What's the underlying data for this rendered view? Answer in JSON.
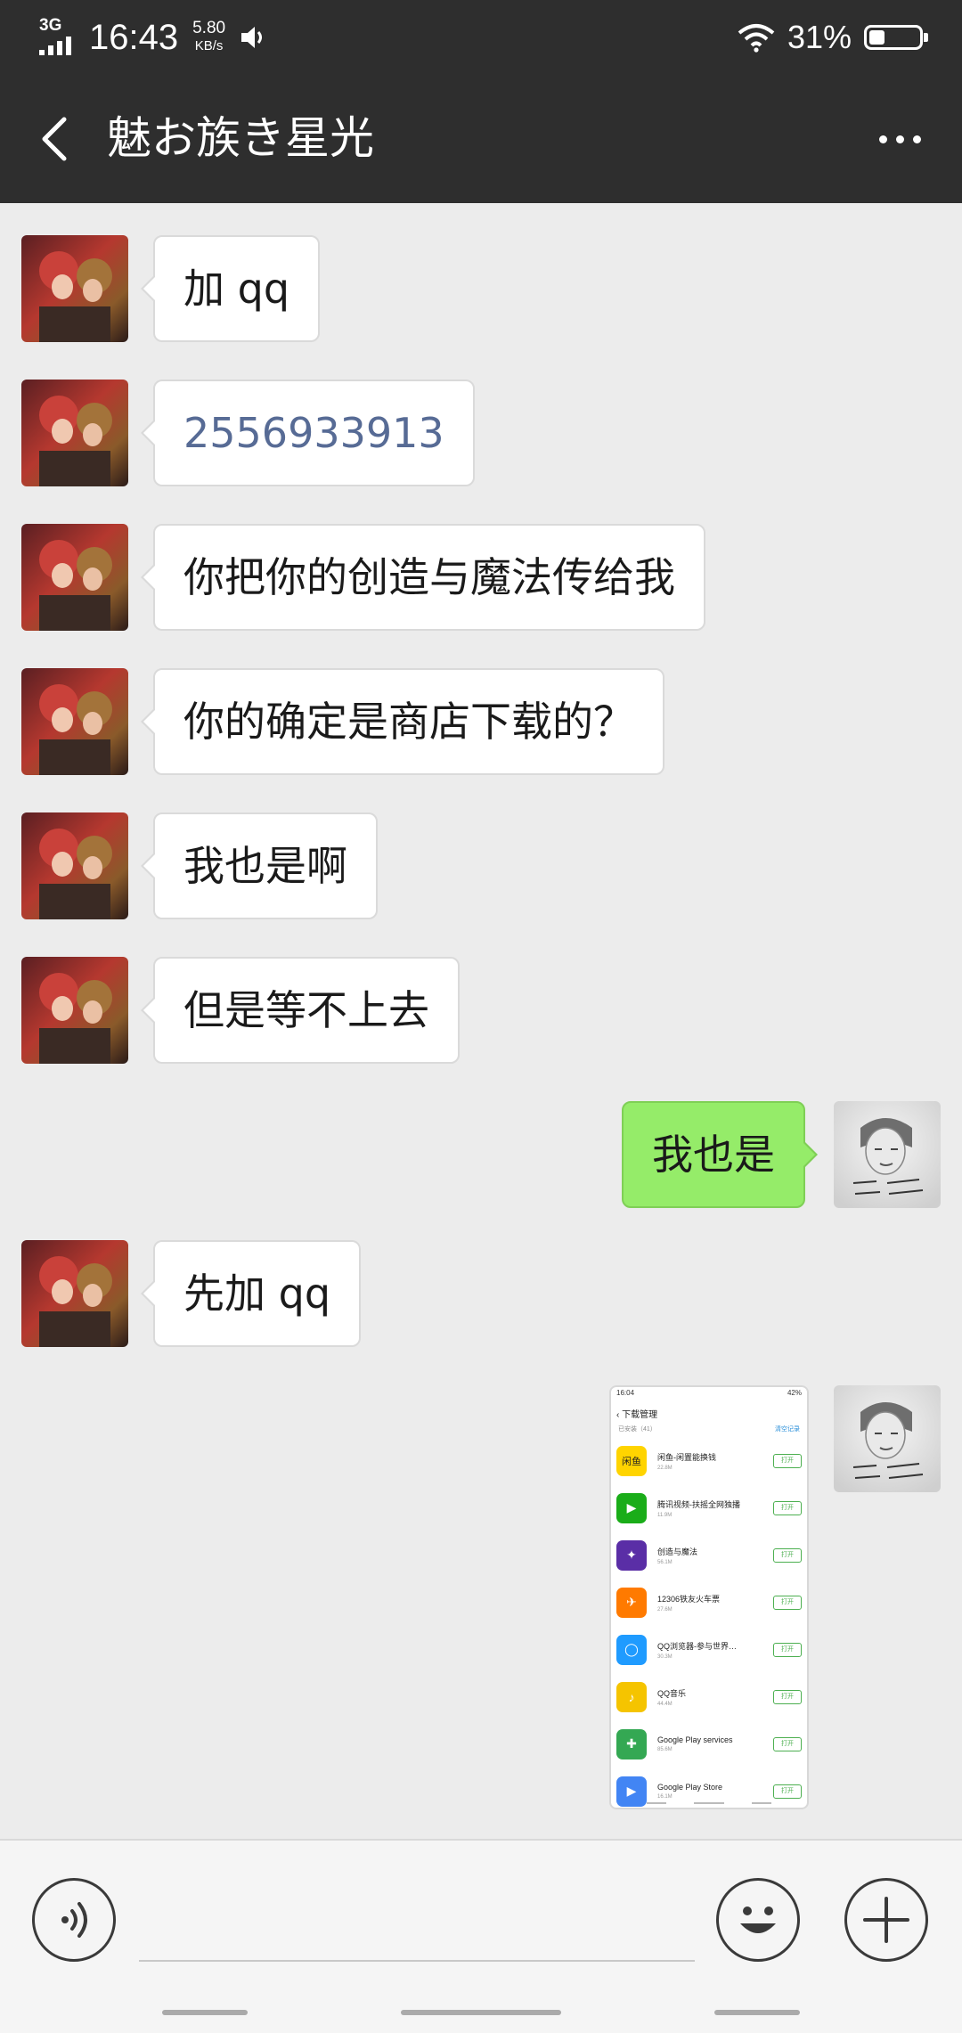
{
  "status_bar": {
    "network": "3G",
    "time": "16:43",
    "speed_value": "5.80",
    "speed_unit": "KB/s",
    "battery_text": "31%",
    "battery_level": 0.31
  },
  "header": {
    "title": "魅お族き星光"
  },
  "messages": [
    {
      "side": "left",
      "text": "加 qq"
    },
    {
      "side": "left",
      "text": "2556933913"
    },
    {
      "side": "left",
      "text": "你把你的创造与魔法传给我"
    },
    {
      "side": "left",
      "text": "你的确定是商店下载的？"
    },
    {
      "side": "left",
      "text": "我也是啊"
    },
    {
      "side": "left",
      "text": "但是等不上去"
    },
    {
      "side": "right",
      "text": "我也是"
    },
    {
      "side": "left",
      "text": "先加 qq"
    }
  ],
  "screenshot": {
    "status_time": "16:04",
    "status_battery": "42%",
    "title": "下载管理",
    "subtitle": "已安装（41）",
    "clear_label": "清空记录",
    "apps": [
      {
        "name": "闲鱼-闲置能换钱",
        "size": "22.8M",
        "icon": "闲鱼",
        "color": "#ffd400",
        "button": "打开"
      },
      {
        "name": "腾讯视频-扶摇全网独播",
        "size": "11.9M",
        "icon": "▶",
        "color": "#1aad19",
        "button": "打开"
      },
      {
        "name": "创造与魔法",
        "size": "56.1M",
        "icon": "✦",
        "color": "#5a2ea6",
        "button": "打开"
      },
      {
        "name": "12306铁友火车票",
        "size": "27.6M",
        "icon": "✈",
        "color": "#ff7a00",
        "button": "打开"
      },
      {
        "name": "QQ浏览器-参与世界…",
        "size": "30.3M",
        "icon": "◯",
        "color": "#1f9bff",
        "button": "打开"
      },
      {
        "name": "QQ音乐",
        "size": "44.4M",
        "icon": "♪",
        "color": "#f5c400",
        "button": "打开"
      },
      {
        "name": "Google Play services",
        "size": "85.6M",
        "icon": "✚",
        "color": "#34a853",
        "button": "打开"
      },
      {
        "name": "Google Play Store",
        "size": "16.1M",
        "icon": "▶",
        "color": "#4285f4",
        "button": "打开"
      }
    ]
  },
  "colors": {
    "header_bg": "#2e2e2e",
    "chat_bg": "#ececec",
    "bubble_self": "#95ec69",
    "bubble_other": "#ffffff",
    "link": "#576b95"
  },
  "icons": {
    "back": "chevron-left-icon",
    "more": "more-dots-icon",
    "voice": "voice-icon",
    "emoji": "emoji-icon",
    "plus": "plus-icon",
    "mute": "speaker-mute-icon",
    "wifi": "wifi-icon",
    "battery": "battery-icon"
  }
}
